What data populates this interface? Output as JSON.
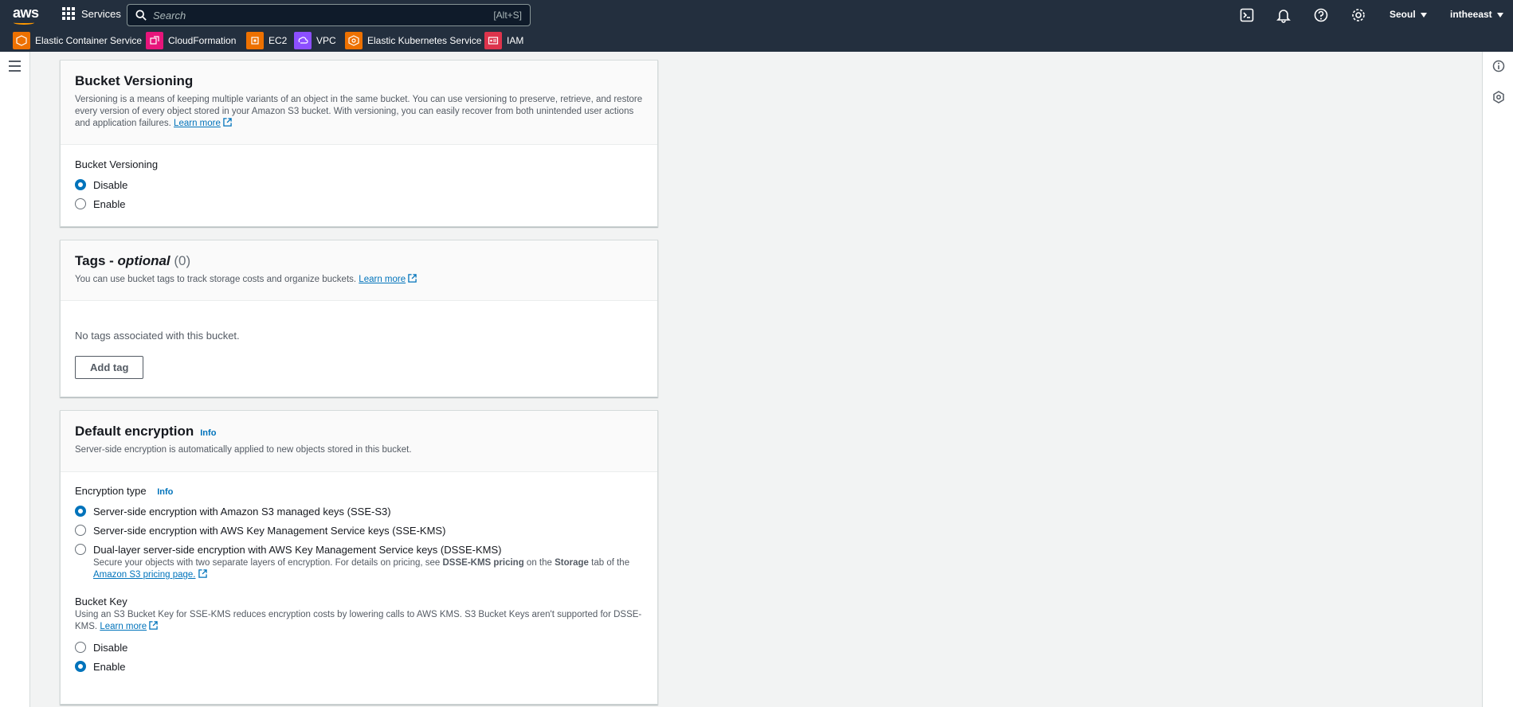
{
  "nav": {
    "logo": "aws",
    "services": "Services",
    "search_placeholder": "Search",
    "search_shortcut": "[Alt+S]",
    "region": "Seoul",
    "account": "intheeast"
  },
  "favorites": [
    {
      "label": "Elastic Container Service",
      "color": "#ed7100",
      "icon": "container-icon"
    },
    {
      "label": "CloudFormation",
      "color": "#e7157b",
      "icon": "cloudformation-icon"
    },
    {
      "label": "EC2",
      "color": "#ed7100",
      "icon": "ec2-icon"
    },
    {
      "label": "VPC",
      "color": "#8c4fff",
      "icon": "vpc-icon"
    },
    {
      "label": "Elastic Kubernetes Service",
      "color": "#ed7100",
      "icon": "kubernetes-icon"
    },
    {
      "label": "IAM",
      "color": "#dd344c",
      "icon": "iam-icon"
    }
  ],
  "versioning": {
    "title": "Bucket Versioning",
    "description": "Versioning is a means of keeping multiple variants of an object in the same bucket. You can use versioning to preserve, retrieve, and restore every version of every object stored in your Amazon S3 bucket. With versioning, you can easily recover from both unintended user actions and application failures.",
    "learn_more": "Learn more",
    "field_label": "Bucket Versioning",
    "options": [
      {
        "label": "Disable",
        "selected": true
      },
      {
        "label": "Enable",
        "selected": false
      }
    ]
  },
  "tags": {
    "title_prefix": "Tags -",
    "title_optional": "optional",
    "count": "(0)",
    "description": "You can use bucket tags to track storage costs and organize buckets.",
    "learn_more": "Learn more",
    "empty": "No tags associated with this bucket.",
    "add_button": "Add tag"
  },
  "encryption": {
    "title": "Default encryption",
    "info": "Info",
    "description": "Server-side encryption is automatically applied to new objects stored in this bucket.",
    "type_label": "Encryption type",
    "type_info": "Info",
    "options": [
      {
        "label": "Server-side encryption with Amazon S3 managed keys (SSE-S3)",
        "selected": true
      },
      {
        "label": "Server-side encryption with AWS Key Management Service keys (SSE-KMS)",
        "selected": false
      },
      {
        "label": "Dual-layer server-side encryption with AWS Key Management Service keys (DSSE-KMS)",
        "selected": false
      }
    ],
    "dsse_desc_1": "Secure your objects with two separate layers of encryption. For details on pricing, see ",
    "dsse_desc_bold1": "DSSE-KMS pricing",
    "dsse_desc_2": " on the ",
    "dsse_desc_bold2": "Storage",
    "dsse_desc_3": " tab of the",
    "dsse_link": "Amazon S3 pricing page.",
    "bucket_key_label": "Bucket Key",
    "bucket_key_desc": "Using an S3 Bucket Key for SSE-KMS reduces encryption costs by lowering calls to AWS KMS. S3 Bucket Keys aren't supported for DSSE-KMS.",
    "bucket_key_learn_more": "Learn more",
    "bucket_key_options": [
      {
        "label": "Disable",
        "selected": false
      },
      {
        "label": "Enable",
        "selected": true
      }
    ]
  }
}
